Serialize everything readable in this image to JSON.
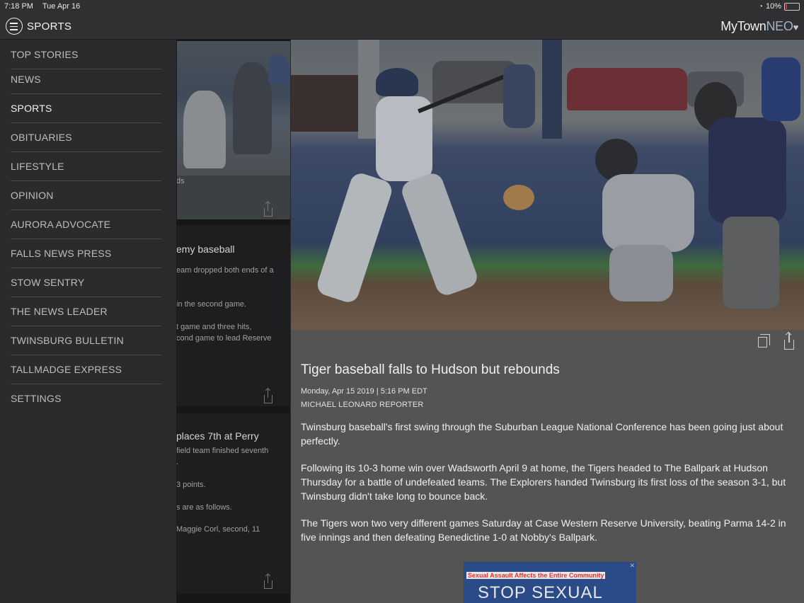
{
  "status_bar": {
    "time": "7:18 PM",
    "date": "Tue Apr 16",
    "battery": "10%",
    "battery_level": 0.1
  },
  "nav": {
    "title": "SPORTS",
    "brand_a": "MyTown",
    "brand_b": "NEO"
  },
  "drawer": {
    "items": [
      {
        "label": "TOP STORIES"
      },
      {
        "label": "NEWS"
      },
      {
        "label": "SPORTS",
        "active": true
      },
      {
        "label": "OBITUARIES"
      },
      {
        "label": "LIFESTYLE"
      },
      {
        "label": "OPINION"
      },
      {
        "label": "AURORA ADVOCATE"
      },
      {
        "label": "FALLS NEWS PRESS"
      },
      {
        "label": "STOW SENTRY"
      },
      {
        "label": "THE NEWS LEADER"
      },
      {
        "label": "TWINSBURG BULLETIN"
      },
      {
        "label": "TALLMADGE EXPRESS"
      },
      {
        "label": "SETTINGS"
      }
    ]
  },
  "list": {
    "card1": {
      "caption_fragment": "ds"
    },
    "card2": {
      "headline_fragment": "emy baseball",
      "lines": [
        "eam dropped both ends of a",
        "in the second game.",
        "t game and three hits,",
        "cond game to lead Reserve"
      ]
    },
    "card3": {
      "headline_fragment": "places 7th at Perry",
      "lines": [
        "field team finished seventh",
        ".",
        "3 points.",
        "s are as follows.",
        "Maggie Corl, second, 11"
      ]
    }
  },
  "article": {
    "headline": "Tiger baseball falls to Hudson but rebounds",
    "date": "Monday, Apr 15 2019 | 5:16 PM EDT",
    "byline": "MICHAEL LEONARD REPORTER",
    "paragraphs": [
      "Twinsburg baseball's first swing through the Suburban League National Conference has been going just about perfectly.",
      "Following its 10-3 home win over Wadsworth April 9 at home, the Tigers headed to The Ballpark at Hudson Thursday for a battle of undefeated teams. The Explorers handed Twinsburg its first loss of the season 3-1, but Twinsburg didn't take long to bounce back.",
      "The Tigers won two very different games Saturday at Case Western Reserve University, beating Parma 14-2 in five innings and then defeating Benedictine 1-0 at Nobby's Ballpark."
    ],
    "ad": {
      "line1": "Sexual Assault Affects the Entire Community",
      "line2": "STOP SEXUAL ASSAULT"
    }
  }
}
